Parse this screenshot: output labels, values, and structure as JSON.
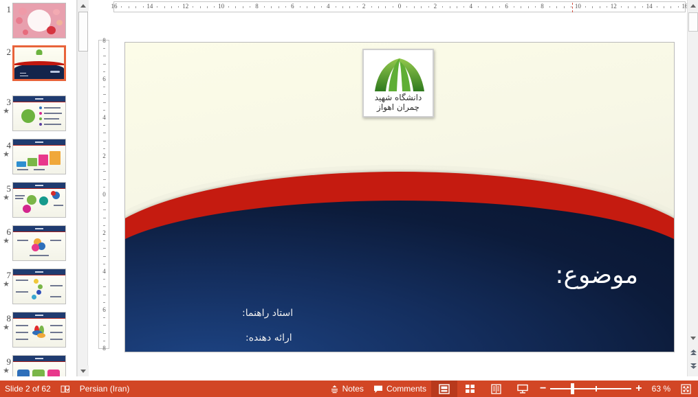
{
  "app": {
    "name": "PowerPoint"
  },
  "thumbnails": {
    "items": [
      {
        "number": "1",
        "animated": false,
        "kind": "pink-floral"
      },
      {
        "number": "2",
        "animated": false,
        "kind": "title-slide",
        "selected": true
      },
      {
        "number": "3",
        "animated": true,
        "kind": "content"
      },
      {
        "number": "4",
        "animated": true,
        "kind": "content"
      },
      {
        "number": "5",
        "animated": true,
        "kind": "content"
      },
      {
        "number": "6",
        "animated": true,
        "kind": "content"
      },
      {
        "number": "7",
        "animated": true,
        "kind": "content"
      },
      {
        "number": "8",
        "animated": true,
        "kind": "content"
      },
      {
        "number": "9",
        "animated": true,
        "kind": "content"
      }
    ],
    "animation_star": "★"
  },
  "rulers": {
    "horizontal_ticks": [
      "16",
      "14",
      "12",
      "10",
      "8",
      "6",
      "4",
      "2",
      "0",
      "2",
      "4",
      "6",
      "8",
      "10",
      "12",
      "14",
      "16"
    ],
    "vertical_ticks": [
      "8",
      "6",
      "4",
      "2",
      "0",
      "2",
      "4",
      "6",
      "8"
    ],
    "unit": "cm"
  },
  "slide": {
    "logo": {
      "caption": "دانشگاه شهید چمران اهواز",
      "icon_name": "university-fan-logo"
    },
    "subject_label": "موضوع:",
    "advisor_label": "استاد راهنما:",
    "presenter_label": "ارائه دهنده:",
    "colors": {
      "background": "#f7f7e6",
      "navy": "#14305f",
      "red": "#c51b10",
      "logo_green": "#5ea832"
    }
  },
  "status_bar": {
    "slide_counter": "Slide 2 of 62",
    "proofing_icon": "spellcheck-icon",
    "language": "Persian (Iran)",
    "notes_label": "Notes",
    "notes_icon": "notes-icon",
    "comments_label": "Comments",
    "comments_icon": "comment-icon",
    "views": [
      {
        "name": "normal-view",
        "icon": "normal-view-icon",
        "active": true
      },
      {
        "name": "slide-sorter-view",
        "icon": "slide-sorter-icon",
        "active": false
      },
      {
        "name": "reading-view",
        "icon": "reading-view-icon",
        "active": false
      },
      {
        "name": "slide-show-view",
        "icon": "slide-show-icon",
        "active": false
      }
    ],
    "zoom_out_label": "−",
    "zoom_in_label": "+",
    "zoom_level": "63 %",
    "fit_button_icon": "fit-to-window-icon",
    "background": "#d24625"
  },
  "scrollbars": {
    "up_arrow": "▲",
    "down_arrow": "▼",
    "previous_slide": "▲",
    "next_slide": "▼"
  }
}
